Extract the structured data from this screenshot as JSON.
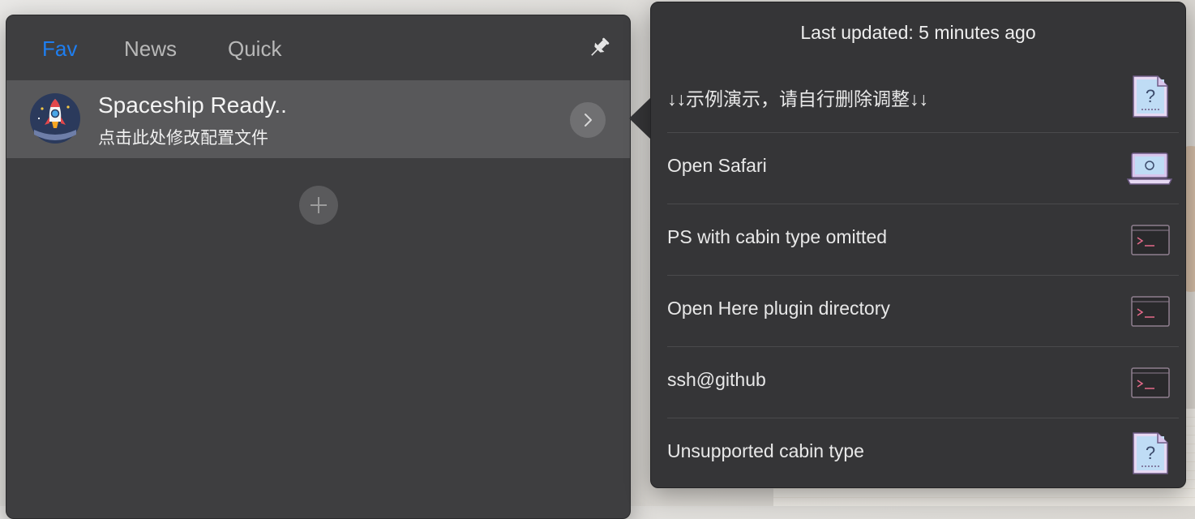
{
  "tabs": [
    {
      "label": "Fav",
      "active": true
    },
    {
      "label": "News",
      "active": false
    },
    {
      "label": "Quick",
      "active": false
    }
  ],
  "fav_item": {
    "title": "Spaceship Ready..",
    "subtitle": "点击此处修改配置文件",
    "icon": "rocket-icon"
  },
  "popover": {
    "header": "Last updated: 5 minutes ago",
    "items": [
      {
        "label": "↓↓示例演示，请自行删除调整↓↓",
        "icon": "question-document-icon"
      },
      {
        "label": "Open Safari",
        "icon": "laptop-icon"
      },
      {
        "label": "PS with cabin type omitted",
        "icon": "terminal-icon"
      },
      {
        "label": "Open Here plugin directory",
        "icon": "terminal-icon"
      },
      {
        "label": "ssh@github",
        "icon": "terminal-icon"
      },
      {
        "label": "Unsupported cabin type",
        "icon": "question-document-icon"
      }
    ]
  },
  "colors": {
    "accent": "#1e7ef0",
    "panel_bg": "#3e3e40",
    "selected_row": "#58585a",
    "popover_bg": "#353537"
  }
}
